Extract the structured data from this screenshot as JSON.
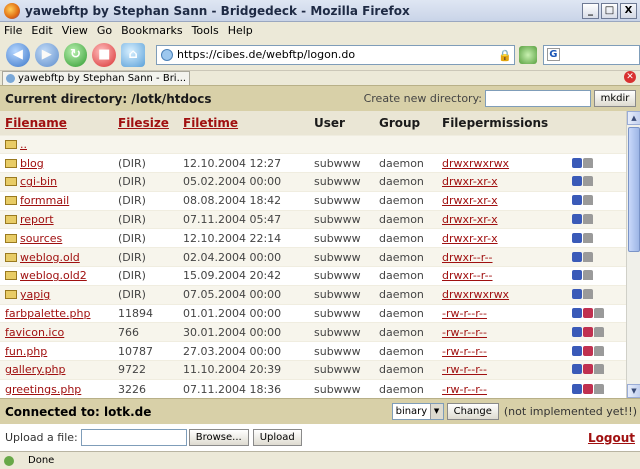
{
  "window": {
    "title": "yawebftp by Stephan Sann - Bridgedeck - Mozilla Firefox",
    "controls": {
      "minimize": "_",
      "maximize": "□",
      "close": "X"
    }
  },
  "menu": [
    "File",
    "Edit",
    "View",
    "Go",
    "Bookmarks",
    "Tools",
    "Help"
  ],
  "navbar": {
    "url": "https://cibes.de/webftp/logon.do",
    "search_glyph": "G"
  },
  "tab": {
    "label": "yawebftp by Stephan Sann - Bri..."
  },
  "page": {
    "current_directory_label": "Current directory: /lotk/htdocs",
    "new_directory_label": "Create new directory:",
    "mkdir_label": "mkdir",
    "columns": [
      "Filename",
      "Filesize",
      "Filetime",
      "User",
      "Group",
      "Filepermissions"
    ],
    "rows": [
      {
        "name": "..",
        "type": "dir",
        "size": "",
        "time": "",
        "user": "",
        "group": "",
        "perm": ""
      },
      {
        "name": "blog",
        "type": "dir",
        "size": "(DIR)",
        "time": "12.10.2004 12:27",
        "user": "subwww",
        "group": "daemon",
        "perm": "drwxrwxrwx"
      },
      {
        "name": "cgi-bin",
        "type": "dir",
        "size": "(DIR)",
        "time": "05.02.2004 00:00",
        "user": "subwww",
        "group": "daemon",
        "perm": "drwxr-xr-x"
      },
      {
        "name": "formmail",
        "type": "dir",
        "size": "(DIR)",
        "time": "08.08.2004 18:42",
        "user": "subwww",
        "group": "daemon",
        "perm": "drwxr-xr-x"
      },
      {
        "name": "report",
        "type": "dir",
        "size": "(DIR)",
        "time": "07.11.2004 05:47",
        "user": "subwww",
        "group": "daemon",
        "perm": "drwxr-xr-x"
      },
      {
        "name": "sources",
        "type": "dir",
        "size": "(DIR)",
        "time": "12.10.2004 22:14",
        "user": "subwww",
        "group": "daemon",
        "perm": "drwxr-xr-x"
      },
      {
        "name": "weblog.old",
        "type": "dir",
        "size": "(DIR)",
        "time": "02.04.2004 00:00",
        "user": "subwww",
        "group": "daemon",
        "perm": "drwxr--r--"
      },
      {
        "name": "weblog.old2",
        "type": "dir",
        "size": "(DIR)",
        "time": "15.09.2004 20:42",
        "user": "subwww",
        "group": "daemon",
        "perm": "drwxr--r--"
      },
      {
        "name": "yapig",
        "type": "dir",
        "size": "(DIR)",
        "time": "07.05.2004 00:00",
        "user": "subwww",
        "group": "daemon",
        "perm": "drwxrwxrwx"
      },
      {
        "name": "farbpalette.php",
        "type": "file",
        "size": "11894",
        "time": "01.01.2004 00:00",
        "user": "subwww",
        "group": "daemon",
        "perm": "-rw-r--r--"
      },
      {
        "name": "favicon.ico",
        "type": "file",
        "size": "766",
        "time": "30.01.2004 00:00",
        "user": "subwww",
        "group": "daemon",
        "perm": "-rw-r--r--"
      },
      {
        "name": "fun.php",
        "type": "file",
        "size": "10787",
        "time": "27.03.2004 00:00",
        "user": "subwww",
        "group": "daemon",
        "perm": "-rw-r--r--"
      },
      {
        "name": "gallery.php",
        "type": "file",
        "size": "9722",
        "time": "11.10.2004 20:39",
        "user": "subwww",
        "group": "daemon",
        "perm": "-rw-r--r--"
      },
      {
        "name": "greetings.php",
        "type": "file",
        "size": "3226",
        "time": "07.11.2004 18:36",
        "user": "subwww",
        "group": "daemon",
        "perm": "-rw-r--r--"
      }
    ],
    "connected_label": "Connected to: lotk.de",
    "transfer_mode": "binary",
    "change_label": "Change",
    "not_implemented_note": "(not implemented yet!!)",
    "upload_label": "Upload a file:",
    "browse_label": "Browse...",
    "upload_button_label": "Upload",
    "logout_label": "Logout"
  },
  "statusbar": {
    "text": "Done"
  }
}
